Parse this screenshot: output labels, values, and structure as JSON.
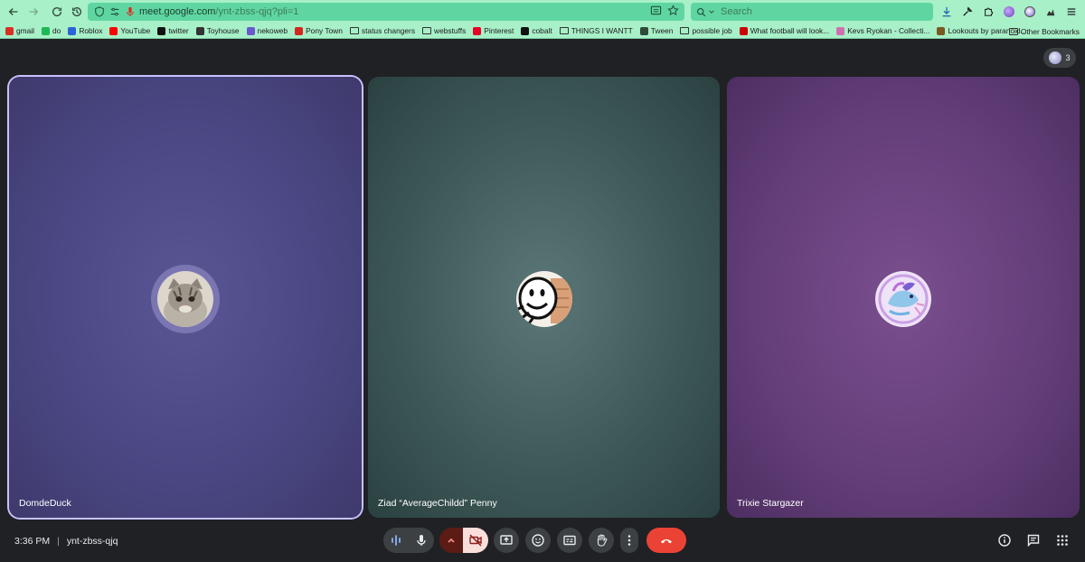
{
  "browser": {
    "url_host": "meet.google.com",
    "url_path": "/ynt-zbss-qjq?pli=1",
    "search_placeholder": "Search",
    "bookmarks": [
      {
        "label": "gmail",
        "color": "#d93025",
        "kind": "icon"
      },
      {
        "label": "do",
        "color": "#1db954",
        "kind": "icon"
      },
      {
        "label": "Roblox",
        "color": "#2a64d6",
        "kind": "icon"
      },
      {
        "label": "YouTube",
        "color": "#ff0000",
        "kind": "icon"
      },
      {
        "label": "twitter",
        "color": "#111111",
        "kind": "icon"
      },
      {
        "label": "Toyhouse",
        "color": "#333333",
        "kind": "icon"
      },
      {
        "label": "nekoweb",
        "color": "#6a5acd",
        "kind": "icon"
      },
      {
        "label": "Pony Town",
        "color": "#d2261e",
        "kind": "icon"
      },
      {
        "label": "status changers",
        "color": "",
        "kind": "folder"
      },
      {
        "label": "webstuffs",
        "color": "",
        "kind": "folder"
      },
      {
        "label": "Pinterest",
        "color": "#e60023",
        "kind": "icon"
      },
      {
        "label": "cobalt",
        "color": "#111111",
        "kind": "icon"
      },
      {
        "label": "THINGS I WANTT",
        "color": "",
        "kind": "folder"
      },
      {
        "label": "Tween",
        "color": "#2e4a3a",
        "kind": "icon"
      },
      {
        "label": "possible job",
        "color": "",
        "kind": "folder"
      },
      {
        "label": "What football will look...",
        "color": "#cc0000",
        "kind": "icon"
      },
      {
        "label": "Kevs Ryokan - Collecti...",
        "color": "#d070b0",
        "kind": "icon"
      },
      {
        "label": "Lookouts by paranoid...",
        "color": "#7a5a20",
        "kind": "icon"
      }
    ],
    "other_bookmarks": "Other Bookmarks"
  },
  "meet": {
    "participant_count": "3",
    "tiles": [
      {
        "name": "DomdeDuck",
        "avatar": "cat-photo"
      },
      {
        "name": "Ziad “AverageChildd” Penny",
        "avatar": "smiley-drawing"
      },
      {
        "name": "Trixie Stargazer",
        "avatar": "pony-art"
      }
    ],
    "time": "3:36 PM",
    "separator": "|",
    "meeting_code": "ynt-zbss-qjq"
  },
  "colors": {
    "toolbar_bg": "#a8f0c8",
    "urlbar_bg": "#5fd6a2",
    "meet_bg": "#202124",
    "active_tile_border": "#c7c2ff",
    "end_call": "#ea4335",
    "cam_off_bg": "#f9dedc"
  },
  "icons": {
    "back": "arrow-left-icon",
    "forward": "arrow-right-icon",
    "reload": "reload-icon",
    "history": "history-icon",
    "mic_activity": "audio-level-icon",
    "mic": "mic-icon",
    "more_options": "chevron-up-icon",
    "camera": "camera-off-icon",
    "present": "present-screen-icon",
    "emoji": "emoji-icon",
    "captions": "captions-icon",
    "hand": "raise-hand-icon",
    "more": "more-vert-icon",
    "end_call": "end-call-icon",
    "info": "info-icon",
    "chat": "chat-icon",
    "activities": "apps-grid-icon"
  }
}
